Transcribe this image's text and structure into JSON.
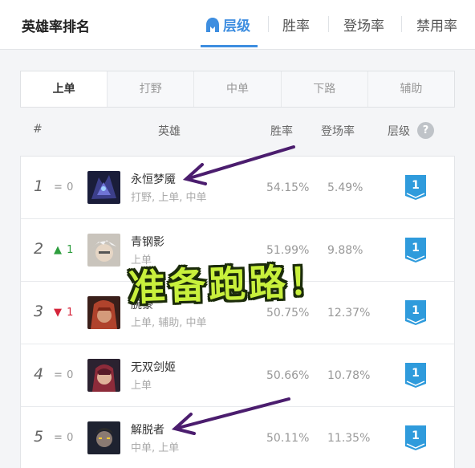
{
  "header": {
    "title": "英雄率排名",
    "tabs": [
      {
        "label": "层级",
        "active": true
      },
      {
        "label": "胜率",
        "active": false
      },
      {
        "label": "登场率",
        "active": false
      },
      {
        "label": "禁用率",
        "active": false
      }
    ]
  },
  "positions": [
    {
      "label": "上单",
      "active": true
    },
    {
      "label": "打野",
      "active": false
    },
    {
      "label": "中单",
      "active": false
    },
    {
      "label": "下路",
      "active": false
    },
    {
      "label": "辅助",
      "active": false
    }
  ],
  "table": {
    "columns": {
      "rank": "#",
      "hero": "英雄",
      "winrate": "胜率",
      "pickrate": "登场率",
      "tier": "层级",
      "help": "?"
    },
    "rows": [
      {
        "rank": "1",
        "trend": "same",
        "trend_symbol": "=",
        "trend_value": "0",
        "name": "永恒梦魇",
        "positions": "打野, 上单, 中单",
        "winrate": "54.15%",
        "pickrate": "5.49%",
        "tier": "1"
      },
      {
        "rank": "2",
        "trend": "up",
        "trend_symbol": "▲",
        "trend_value": "1",
        "name": "青钢影",
        "positions": "上单",
        "winrate": "51.99%",
        "pickrate": "9.88%",
        "tier": "1"
      },
      {
        "rank": "3",
        "trend": "down",
        "trend_symbol": "▼",
        "trend_value": "1",
        "name": "腕豪",
        "positions": "上单, 辅助, 中单",
        "winrate": "50.75%",
        "pickrate": "12.37%",
        "tier": "1"
      },
      {
        "rank": "4",
        "trend": "same",
        "trend_symbol": "=",
        "trend_value": "0",
        "name": "无双剑姬",
        "positions": "上单",
        "winrate": "50.66%",
        "pickrate": "10.78%",
        "tier": "1"
      },
      {
        "rank": "5",
        "trend": "same",
        "trend_symbol": "=",
        "trend_value": "0",
        "name": "解脱者",
        "positions": "中单, 上单",
        "winrate": "50.11%",
        "pickrate": "11.35%",
        "tier": "1"
      }
    ]
  },
  "overlay": {
    "text": "准备跑路！"
  },
  "colors": {
    "accent": "#3e8ee0",
    "tier_badge": "#2f9bdc",
    "overlay_text": "#c8f03c",
    "arrow": "#4b1d6e"
  }
}
